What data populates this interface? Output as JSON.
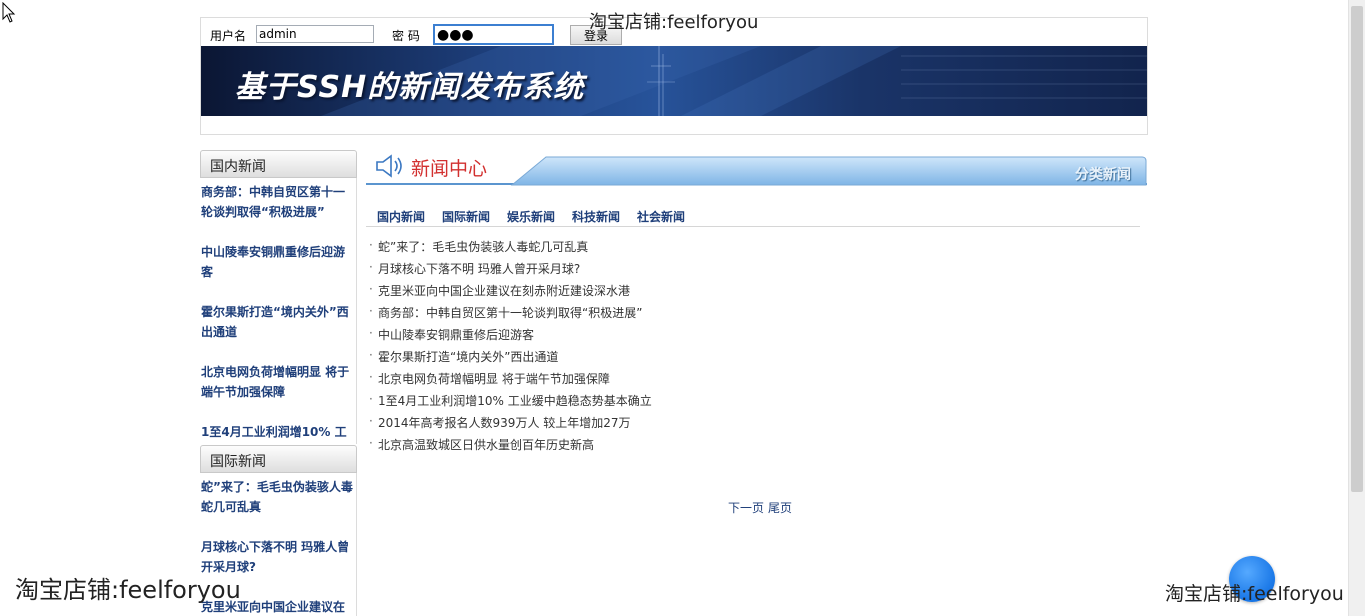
{
  "header": {
    "username_label": "用户名",
    "username_value": "admin",
    "password_label": "密 码",
    "password_value": "●●●",
    "login_button": "登录",
    "banner_title": "基于SSH的新闻发布系统"
  },
  "watermarks": {
    "top": "淘宝店铺:feelforyou",
    "left": "淘宝店铺:feelforyou",
    "right": "淘宝店铺:feelforyou"
  },
  "sidebar": {
    "domestic": {
      "title": "国内新闻",
      "items": [
        "商务部：中韩自贸区第十一轮谈判取得“积极进展”",
        "中山陵奉安铜鼎重修后迎游客",
        "霍尔果斯打造“境内关外”西出通道",
        "北京电网负荷增幅明显 将于端午节加强保障",
        "1至4月工业利润增10% 工"
      ]
    },
    "international": {
      "title": "国际新闻",
      "items": [
        "蛇”来了：毛毛虫伪装骇人毒蛇几可乱真",
        "月球核心下落不明 玛雅人曾开采月球?",
        "克里米亚向中国企业建议在"
      ]
    }
  },
  "main": {
    "section_title": "新闻中心",
    "category_tag": "分类新闻",
    "tabs": [
      "国内新闻",
      "国际新闻",
      "娱乐新闻",
      "科技新闻",
      "社会新闻"
    ],
    "bullet": "·",
    "news": [
      "蛇”来了：毛毛虫伪装骇人毒蛇几可乱真",
      "月球核心下落不明 玛雅人曾开采月球?",
      "克里米亚向中国企业建议在刻赤附近建设深水港",
      "商务部：中韩自贸区第十一轮谈判取得“积极进展”",
      "中山陵奉安铜鼎重修后迎游客",
      "霍尔果斯打造“境内关外”西出通道",
      "北京电网负荷增幅明显 将于端午节加强保障",
      "1至4月工业利润增10% 工业缓中趋稳态势基本确立",
      "2014年高考报名人数939万人 较上年增加27万",
      "北京高温致城区日供水量创百年历史新高"
    ],
    "pager": {
      "next": "下一页",
      "last": "尾页"
    }
  },
  "colors": {
    "link_blue": "#1f3f7a",
    "title_red": "#d2302f",
    "banner_dark": "#0b1633",
    "accent_blue": "#3c7fd1"
  },
  "icons": {
    "cursor": "arrow-cursor-icon",
    "speaker": "speaker-icon",
    "back_to_top": "back-to-top-icon"
  }
}
